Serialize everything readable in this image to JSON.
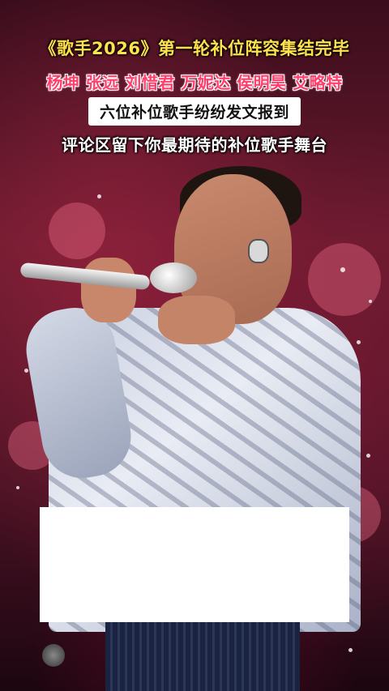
{
  "caption": {
    "title": "《歌手2026》第一轮补位阵容集结完毕",
    "names": "杨坤 张远 刘惜君 万妮达 侯明昊 艾略特",
    "highlight": "六位补位歌手纷纷发文报到",
    "cta": "评论区留下你最期待的补位歌手舞台"
  },
  "colors": {
    "title": "#ffe14d",
    "names": "#ff3e6c",
    "highlight_bg": "#ffffff",
    "cta": "#ffffff"
  }
}
